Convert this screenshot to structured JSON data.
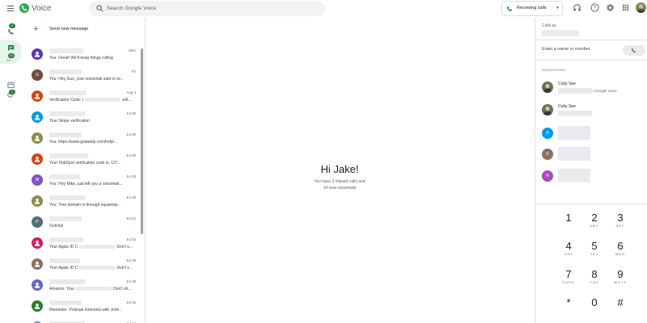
{
  "app": {
    "title": "Voice"
  },
  "search": {
    "placeholder": "Search Google Voice"
  },
  "status": {
    "receiving_label": "Receiving calls"
  },
  "nav": {
    "calls_badge": "3",
    "messages_badge": "13",
    "messages_sub": "9.9",
    "voicemail_badge": "1"
  },
  "list": {
    "send_label": "Send new message",
    "items": [
      {
        "date": "Mon",
        "snippet": "You: Great! We'll keep things rolling",
        "avatar_letter": "",
        "color": "#5e35b1"
      },
      {
        "date": "Fri",
        "snippet": "You: Hey Gus, your voicemail said to se...",
        "avatar_letter": "G",
        "color": "#6d4c41"
      },
      {
        "date": "Aug 4",
        "snippet": "Verification Code: t",
        "snippet_tail": "will...",
        "avatar_letter": "",
        "color": "#d84315"
      },
      {
        "date": "Jul 30",
        "snippet": "Your Stripe verification",
        "avatar_letter": "",
        "color": "#039be5"
      },
      {
        "date": "Jul 30",
        "snippet": "You: https://www.godaddy.com/help/...",
        "avatar_letter": "",
        "color": "#8d8d4a"
      },
      {
        "date": "Jul 30",
        "snippet": "Your HubSpot verification code is: 127...",
        "avatar_letter": "",
        "color": "#d84315"
      },
      {
        "date": "Jul 26",
        "snippet": "You: Hey Mike, just left you a voicemail...",
        "avatar_letter": "M",
        "color": "#7e57c2"
      },
      {
        "date": "Jul 25",
        "snippet": "You: Your domain is through squaresp...",
        "avatar_letter": "",
        "color": "#8d8d4a"
      },
      {
        "date": "Jul 24",
        "snippet": "Gotcha!",
        "avatar_letter": "P",
        "color": "#546e7a"
      },
      {
        "date": "Jul 23",
        "snippet": "Your Apple ID C",
        "snippet_tail": "Don't s...",
        "avatar_letter": "",
        "color": "#d81b60"
      },
      {
        "date": "Jul 19",
        "snippet": "Your Apple ID C",
        "snippet_tail": "Don't s...",
        "avatar_letter": "",
        "color": "#8d6e63"
      },
      {
        "date": "Jul 19",
        "snippet": "Amazon: Your",
        "snippet_tail": "Don't sh...",
        "avatar_letter": "",
        "color": "#5c6bc0"
      },
      {
        "date": "Jul 15",
        "snippet": "Reminder: Podcast Interview with Josh...",
        "avatar_letter": "",
        "color": "#2e7d32"
      },
      {
        "date": "Jul 12",
        "snippet": "",
        "avatar_letter": "",
        "color": "#78909c"
      }
    ]
  },
  "main": {
    "greeting": "Hi Jake!",
    "line1": "You have 3 missed calls and",
    "line2": "14 new voicemails"
  },
  "dialer": {
    "call_as_label": "Calls as",
    "input_placeholder": "Enter a name or number",
    "suggestions_label": "SUGGESTIONS",
    "suggestions": [
      {
        "name": "Cody See",
        "tag": "• Google Voice",
        "letter": "",
        "color": "#6d6d5a"
      },
      {
        "name": "Cody See",
        "tag": "",
        "letter": "",
        "color": "#6d6d5a"
      },
      {
        "name": "",
        "tag": "",
        "letter": "A",
        "color": "#039be5"
      },
      {
        "name": "",
        "tag": "",
        "letter": "K",
        "color": "#8d6e63"
      },
      {
        "name": "",
        "tag": "",
        "letter": "R",
        "color": "#ab47bc"
      }
    ],
    "keys": [
      {
        "d": "1",
        "l": ""
      },
      {
        "d": "2",
        "l": "ABC"
      },
      {
        "d": "3",
        "l": "DEF"
      },
      {
        "d": "4",
        "l": "GHI"
      },
      {
        "d": "5",
        "l": "JKL"
      },
      {
        "d": "6",
        "l": "MNO"
      },
      {
        "d": "7",
        "l": "PQRS"
      },
      {
        "d": "8",
        "l": "TUV"
      },
      {
        "d": "9",
        "l": "WXYZ"
      },
      {
        "d": "*",
        "l": ""
      },
      {
        "d": "0",
        "l": ""
      },
      {
        "d": "#",
        "l": ""
      }
    ]
  },
  "colors": {
    "accent": "#188038",
    "rail_active": "#e6f4ea"
  }
}
